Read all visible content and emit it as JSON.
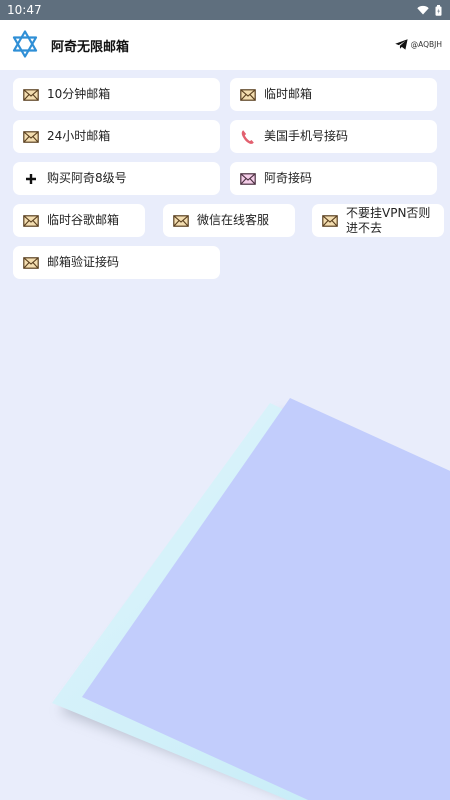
{
  "status": {
    "time": "10:47"
  },
  "app": {
    "title": "阿奇无限邮箱",
    "handle": "@AQBJH"
  },
  "colors": {
    "accent": "#2f8fd6",
    "mail_fill": "#f3ddb0",
    "mail_stroke": "#5a4020",
    "pink_mail_fill": "#f4cde8",
    "phone": "#e2606f",
    "card": "#c2cdfc",
    "card_edge": "#cfeff9"
  },
  "buttons": [
    {
      "id": "ten-minute-mail",
      "icon": "envelope-icon",
      "label": "10分钟邮箱"
    },
    {
      "id": "temp-mail",
      "icon": "envelope-icon",
      "label": "临时邮箱"
    },
    {
      "id": "24h-mail",
      "icon": "envelope-icon",
      "label": "24小时邮箱"
    },
    {
      "id": "us-phone-sms",
      "icon": "phone-icon",
      "label": "美国手机号接码"
    },
    {
      "id": "buy-account",
      "icon": "plus-icon",
      "label": "购买阿奇8级号"
    },
    {
      "id": "aqi-sms",
      "icon": "pink-envelope-icon",
      "label": "阿奇接码"
    },
    {
      "id": "temp-gmail",
      "icon": "envelope-icon",
      "label": "临时谷歌邮箱"
    },
    {
      "id": "wechat-support",
      "icon": "envelope-icon",
      "label": "微信在线客服"
    },
    {
      "id": "no-vpn-notice",
      "icon": "envelope-icon",
      "label": "不要挂VPN否则进不去"
    },
    {
      "id": "email-verify-sms",
      "icon": "envelope-icon",
      "label": "邮箱验证接码"
    }
  ]
}
